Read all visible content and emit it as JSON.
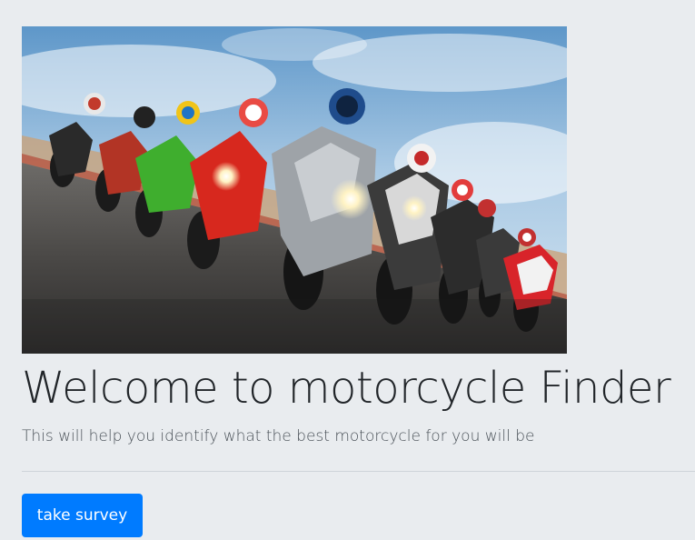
{
  "hero": {
    "alt": "group of sport motorcycles racing on a track"
  },
  "jumbotron": {
    "title": "Welcome to motorcycle Finder",
    "lead": "This will help you identify what the best motorcycle for you will be",
    "button_label": "take survey"
  },
  "colors": {
    "background": "#e9ecef",
    "primary_button": "#007bff",
    "title_text": "#212529"
  }
}
